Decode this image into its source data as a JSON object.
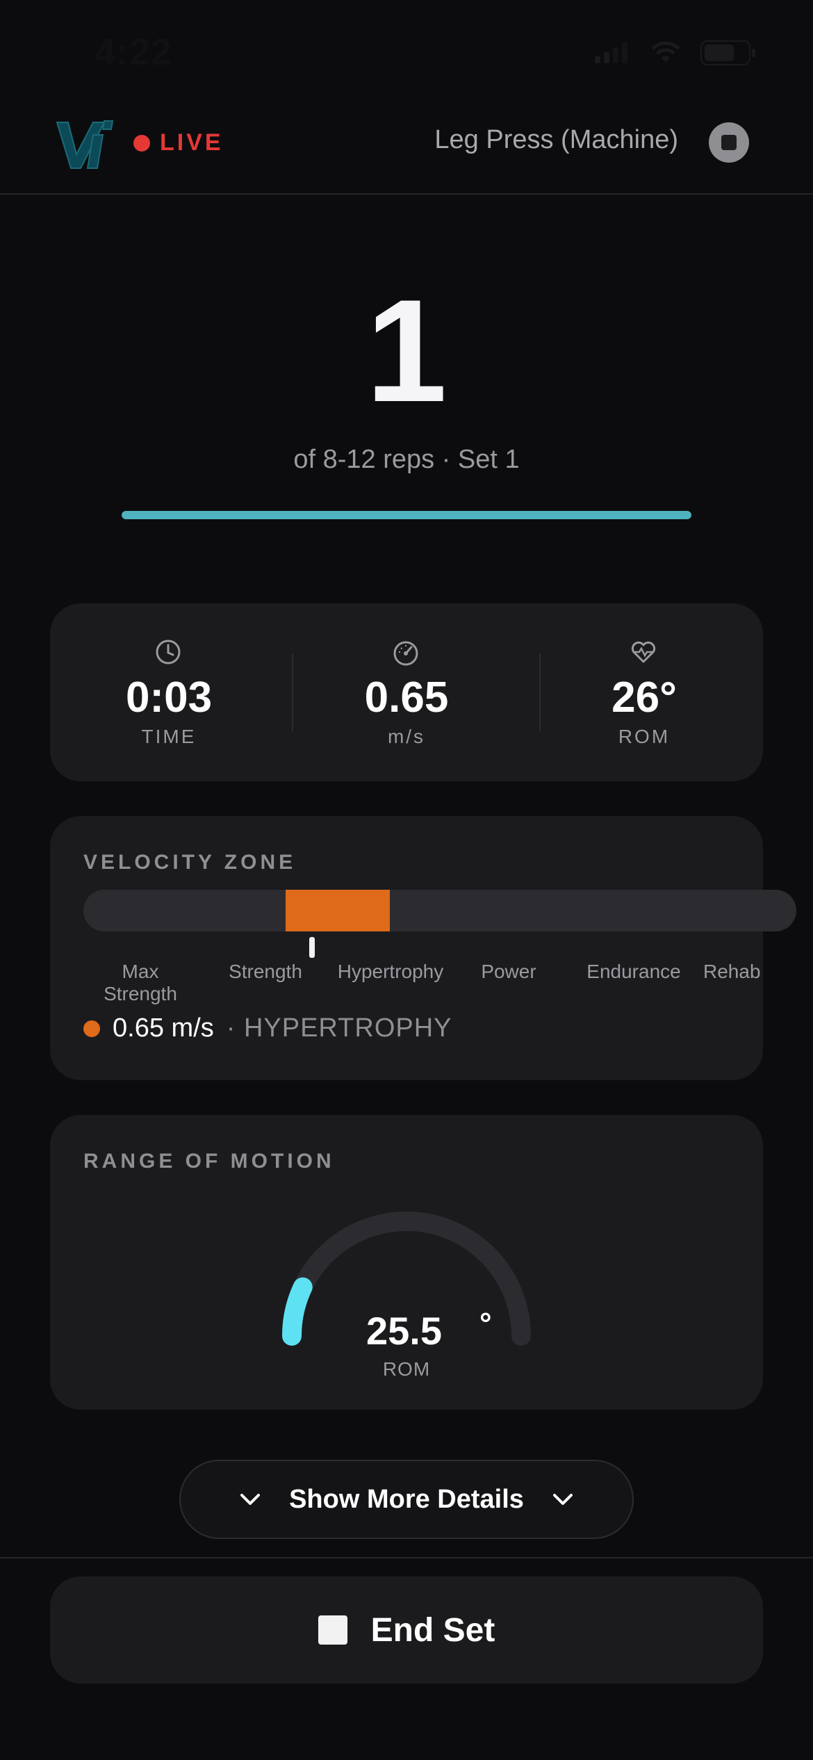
{
  "status_bar": {
    "time": "4:22"
  },
  "header": {
    "live_label": "LIVE",
    "exercise_name": "Leg Press (Machine)",
    "colors": {
      "live": "#e53935"
    }
  },
  "rep": {
    "count": "1",
    "subtitle": "of 8-12 reps · Set 1",
    "progress_fraction": 1.0
  },
  "stats": [
    {
      "icon": "clock-icon",
      "value": "0:03",
      "label": "TIME"
    },
    {
      "icon": "speedometer-icon",
      "value": "0.65",
      "label": "m/s"
    },
    {
      "icon": "heart-pulse-icon",
      "value": "26°",
      "label": "ROM"
    }
  ],
  "velocity_zone": {
    "title": "VELOCITY ZONE",
    "zones": [
      "Max Strength",
      "Strength",
      "Hypertrophy",
      "Power",
      "Endurance",
      "Rehab"
    ],
    "active_zone": "Hypertrophy",
    "speed": "0.65 m/s",
    "zone_name": "· HYPERTROPHY",
    "colors": {
      "active": "#de6a1a"
    }
  },
  "range_of_motion": {
    "title": "RANGE OF MOTION",
    "value": "25.5",
    "unit": "°",
    "label": "ROM",
    "fill_fraction": 0.14,
    "colors": {
      "fill": "#5ee1f2",
      "track": "#2c2c30"
    }
  },
  "more_details": {
    "label": "Show More Details"
  },
  "end_set": {
    "label": "End Set"
  }
}
